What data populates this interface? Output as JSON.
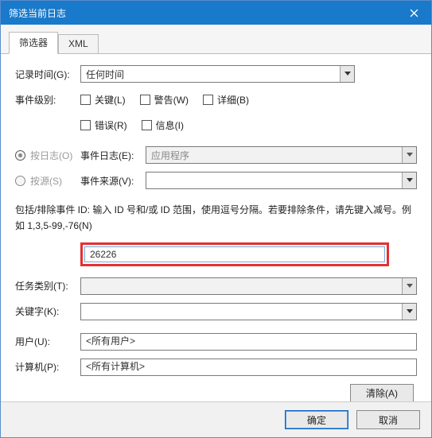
{
  "window": {
    "title": "筛选当前日志"
  },
  "tabs": {
    "filter": "筛选器",
    "xml": "XML"
  },
  "labels": {
    "logged": "记录时间(G):",
    "level": "事件级别:",
    "bylog": "按日志(O)",
    "bysource": "按源(S)",
    "eventlog": "事件日志(E):",
    "eventsource": "事件来源(V):",
    "task": "任务类别(T):",
    "keywords": "关键字(K):",
    "user": "用户(U):",
    "computer": "计算机(P):"
  },
  "timeframe": "任何时间",
  "levels": {
    "critical": "关键(L)",
    "warning": "警告(W)",
    "verbose": "详细(B)",
    "error": "错误(R)",
    "info": "信息(I)"
  },
  "eventlog_value": "应用程序",
  "eventsource_value": "",
  "desc_text": "包括/排除事件 ID: 输入 ID 号和/或 ID 范围，使用逗号分隔。若要排除条件，请先键入减号。例如 1,3,5-99,-76(N)",
  "id_value": "26226",
  "task_value": "",
  "keywords_value": "",
  "user_value": "<所有用户>",
  "computer_value": "<所有计算机>",
  "buttons": {
    "clear": "清除(A)",
    "ok": "确定",
    "cancel": "取消"
  }
}
